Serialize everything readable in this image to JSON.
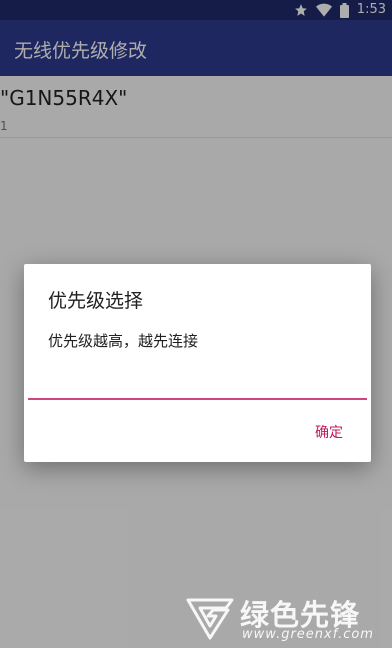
{
  "status_bar": {
    "time": "1:53",
    "icons": [
      "star-icon",
      "wifi-icon",
      "battery-icon"
    ]
  },
  "app_bar": {
    "title": "无线优先级修改"
  },
  "wifi_list": [
    {
      "ssid": "\"G1N55R4X\"",
      "priority": "1"
    }
  ],
  "dialog": {
    "title": "优先级选择",
    "message": "优先级越高，越先连接",
    "input_value": "",
    "confirm_label": "确定"
  },
  "watermark": {
    "brand": "绿色先锋",
    "url": "www.greenxf.com"
  },
  "colors": {
    "status_bar": "#1f2a6b",
    "app_bar": "#2d3a8c",
    "accent": "#c2185b",
    "input_underline": "#d0447f"
  }
}
